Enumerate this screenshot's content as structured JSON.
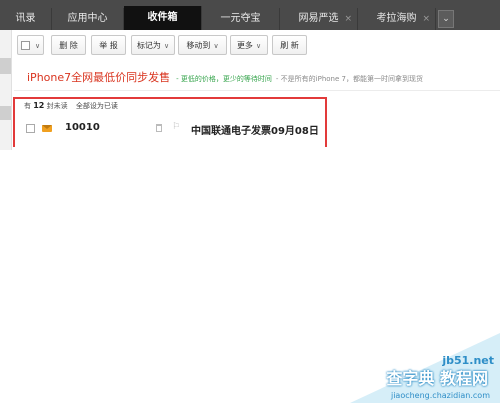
{
  "tabs": [
    {
      "label": "讯录",
      "closable": false,
      "active": false
    },
    {
      "label": "应用中心",
      "closable": false,
      "active": false
    },
    {
      "label": "收件箱",
      "closable": false,
      "active": true
    },
    {
      "label": "一元夺宝",
      "closable": false,
      "active": false
    },
    {
      "label": "网易严选",
      "closable": true,
      "active": false
    },
    {
      "label": "考拉海购",
      "closable": true,
      "active": false
    }
  ],
  "tab_close_symbol": "×",
  "tab_more_symbol": "⌄",
  "toolbar": {
    "select_all_caret": "∨",
    "delete_label": "删 除",
    "report_label": "举 报",
    "mark_as_label": "标记为",
    "move_to_label": "移动到",
    "more_label": "更多",
    "refresh_label": "刷 新"
  },
  "promo": {
    "main": "iPhone7全网最低价同步发售",
    "sub1": "- 更低的价格，更少的等待时间",
    "sub2": "- 不是所有的iPhone 7，都能第一时间拿到现货"
  },
  "unread": {
    "prefix": "有",
    "count": "12",
    "suffix": "封未读",
    "mark_all_link": "全部设为已读"
  },
  "mails": [
    {
      "sender": "10010",
      "subject": "中国联通电子发票09月08日",
      "unread": true
    }
  ],
  "watermark": {
    "site": "jb51.net",
    "cn": "查字典 教程网",
    "url": "jiaocheng.chazidian.com"
  },
  "colors": {
    "tabbar": "#4a4a4a",
    "active_tab": "#111111",
    "promo_red": "#d9341f",
    "promo_green": "#33a34a",
    "highlight_box": "#e23a3a",
    "envelope": "#f0a020"
  }
}
